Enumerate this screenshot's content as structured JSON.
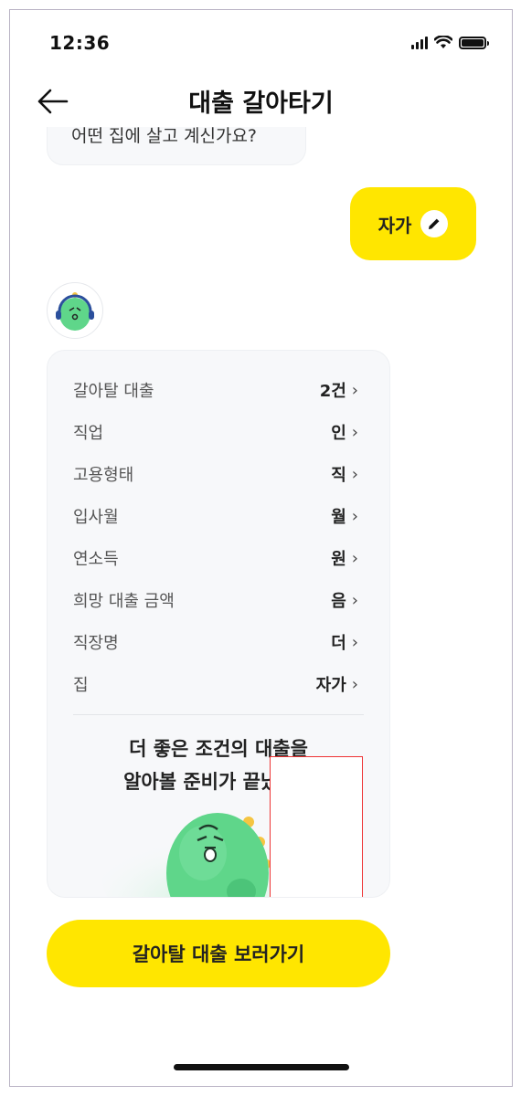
{
  "status_bar": {
    "time": "12:36"
  },
  "header": {
    "title": "대출 갈아타기"
  },
  "prev_message": {
    "text": "어떤 집에 살고 계신가요?"
  },
  "reply": {
    "text": "자가"
  },
  "summary": {
    "rows": [
      {
        "label": "갈아탈 대출",
        "value": "2건"
      },
      {
        "label": "직업",
        "value": "인"
      },
      {
        "label": "고용형태",
        "value": "직"
      },
      {
        "label": "입사월",
        "value": "월"
      },
      {
        "label": "연소득",
        "value": "원"
      },
      {
        "label": "희망 대출 금액",
        "value": "음"
      },
      {
        "label": "직장명",
        "value": "더"
      },
      {
        "label": "집",
        "value": "자가"
      }
    ],
    "message_line1": "더 좋은 조건의 대출을",
    "message_line2": "알아볼 준비가 끝났어요"
  },
  "cta": {
    "label": "갈아탈 대출 보러가기"
  },
  "colors": {
    "accent": "#ffe600",
    "mascot": "#5fd68a",
    "card_bg": "#f7f8fa"
  },
  "icons": [
    "back-arrow-icon",
    "signal-icon",
    "wifi-icon",
    "battery-icon",
    "pencil-icon",
    "chevron-right-icon",
    "mascot-avatar-icon"
  ]
}
